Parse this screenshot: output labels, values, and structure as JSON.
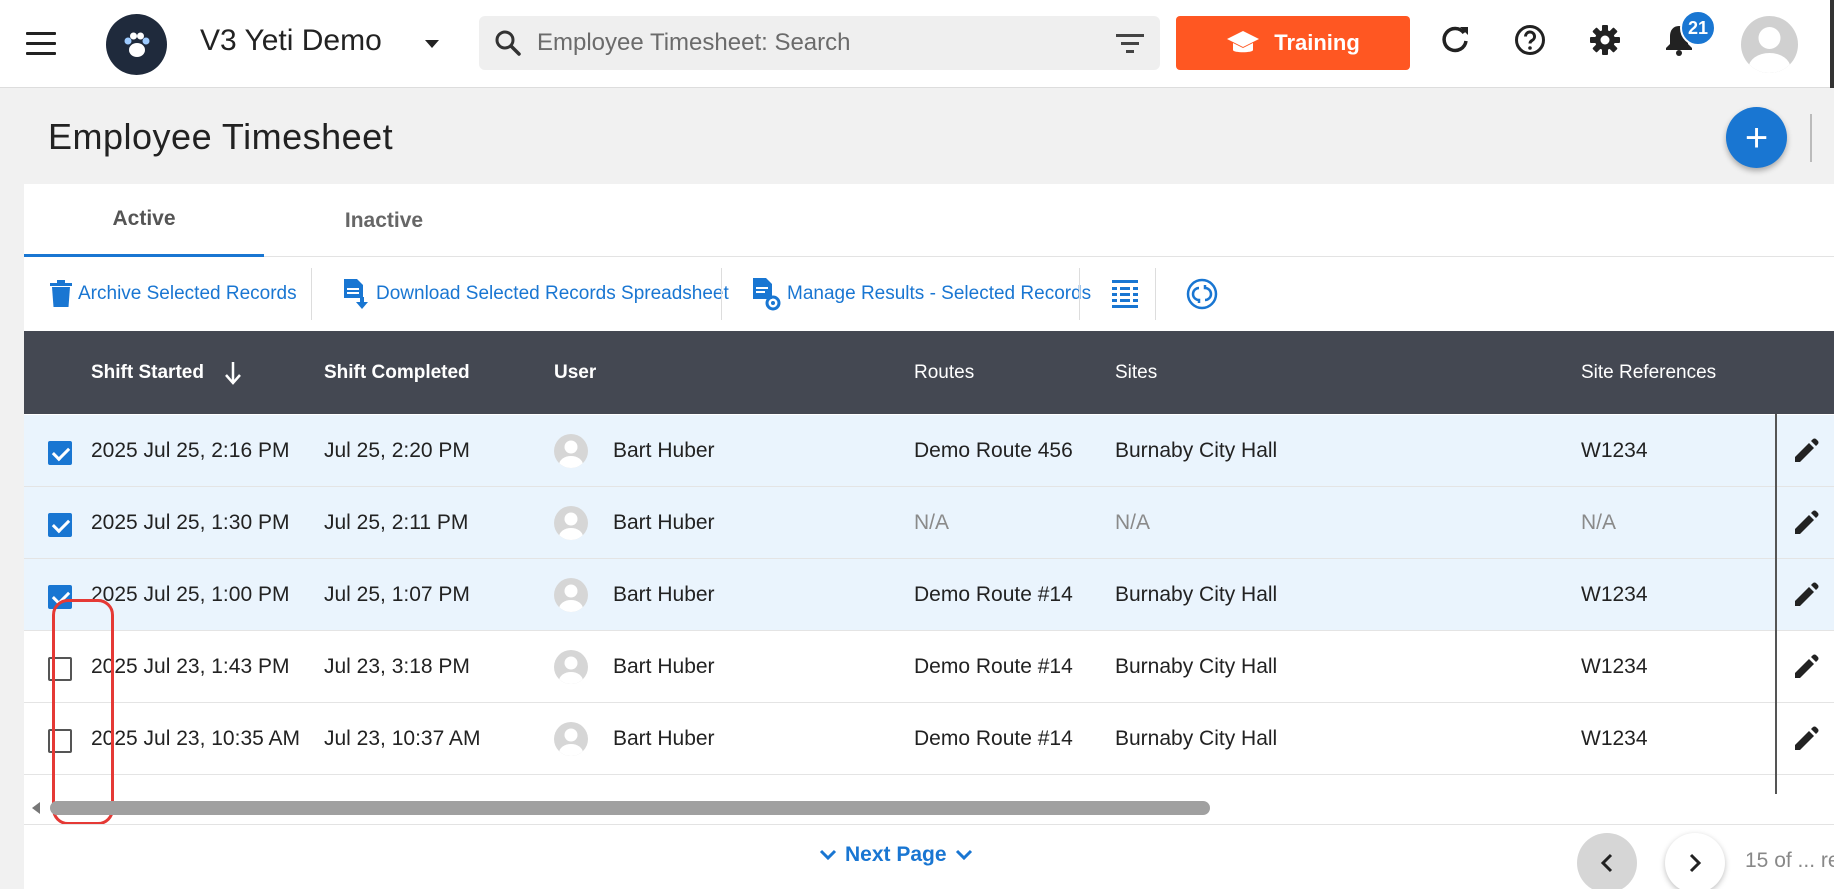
{
  "header": {
    "app_title": "V3 Yeti Demo",
    "search_placeholder": "Employee Timesheet: Search",
    "training_label": "Training",
    "notification_count": "21",
    "accent_color": "#1976d2",
    "training_color": "#ff5722"
  },
  "page": {
    "title": "Employee Timesheet",
    "add_label": "+"
  },
  "tabs": [
    {
      "label": "Active",
      "active": true
    },
    {
      "label": "Inactive",
      "active": false
    }
  ],
  "toolbar": {
    "archive_label": "Archive Selected Records",
    "download_label": "Download Selected Records Spreadsheet",
    "manage_label": "Manage Results - Selected Records"
  },
  "table": {
    "columns": [
      "Shift Started",
      "Shift Completed",
      "User",
      "Routes",
      "Sites",
      "Site References"
    ],
    "sort_column": "Shift Started",
    "sort_direction": "descending",
    "rows": [
      {
        "checked": true,
        "shift_started": "2025 Jul 25, 2:16 PM",
        "shift_completed": "Jul 25, 2:20 PM",
        "user": "Bart Huber",
        "route": "Demo Route 456",
        "site": "Burnaby City Hall",
        "site_ref": "W1234"
      },
      {
        "checked": true,
        "shift_started": "2025 Jul 25, 1:30 PM",
        "shift_completed": "Jul 25, 2:11 PM",
        "user": "Bart Huber",
        "route": "N/A",
        "site": "N/A",
        "site_ref": "N/A"
      },
      {
        "checked": true,
        "shift_started": "2025 Jul 25, 1:00 PM",
        "shift_completed": "Jul 25, 1:07 PM",
        "user": "Bart Huber",
        "route": "Demo Route #14",
        "site": "Burnaby City Hall",
        "site_ref": "W1234"
      },
      {
        "checked": false,
        "shift_started": "2025 Jul 23, 1:43 PM",
        "shift_completed": "Jul 23, 3:18 PM",
        "user": "Bart Huber",
        "route": "Demo Route #14",
        "site": "Burnaby City Hall",
        "site_ref": "W1234"
      },
      {
        "checked": false,
        "shift_started": "2025 Jul 23, 10:35 AM",
        "shift_completed": "Jul 23, 10:37 AM",
        "user": "Bart Huber",
        "route": "Demo Route #14",
        "site": "Burnaby City Hall",
        "site_ref": "W1234"
      }
    ]
  },
  "footer": {
    "next_page_label": "Next Page",
    "page_info": "15 of ... re"
  }
}
